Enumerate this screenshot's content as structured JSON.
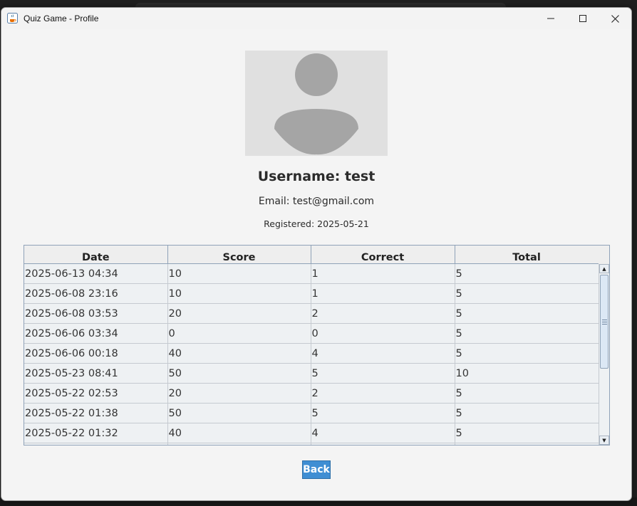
{
  "window": {
    "title": "Quiz Game - Profile"
  },
  "profile": {
    "username_text": "Username: test",
    "email_text": "Email: test@gmail.com",
    "registered_text": "Registered: 2025-05-21"
  },
  "table": {
    "columns": [
      "Date",
      "Score",
      "Correct",
      "Total"
    ],
    "rows": [
      [
        "2025-06-13 04:34",
        "10",
        "1",
        "5"
      ],
      [
        "2025-06-08 23:16",
        "10",
        "1",
        "5"
      ],
      [
        "2025-06-08 03:53",
        "20",
        "2",
        "5"
      ],
      [
        "2025-06-06 03:34",
        "0",
        "0",
        "5"
      ],
      [
        "2025-06-06 00:18",
        "40",
        "4",
        "5"
      ],
      [
        "2025-05-23 08:41",
        "50",
        "5",
        "10"
      ],
      [
        "2025-05-22 02:53",
        "20",
        "2",
        "5"
      ],
      [
        "2025-05-22 01:38",
        "50",
        "5",
        "5"
      ],
      [
        "2025-05-22 01:32",
        "40",
        "4",
        "5"
      ],
      [
        "",
        "",
        "",
        ""
      ]
    ]
  },
  "actions": {
    "back_label": "Back"
  },
  "icons": {
    "app": "java-cup-icon",
    "minimize": "minimize-icon",
    "maximize": "maximize-icon",
    "close": "close-icon",
    "avatar": "user-avatar-icon",
    "scroll_up": "scroll-up-arrow-icon",
    "scroll_down": "scroll-down-arrow-icon"
  },
  "colors": {
    "accent": "#3f8ed3",
    "avatar_bg": "#e0e0e0",
    "avatar_fg": "#a5a5a5"
  }
}
